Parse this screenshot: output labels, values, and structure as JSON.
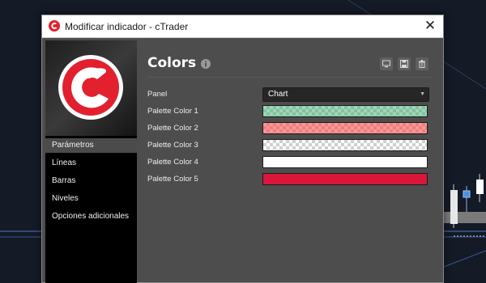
{
  "window": {
    "title": "Modificar indicador - cTrader",
    "close_glyph": "✕"
  },
  "sidebar": {
    "items": [
      {
        "label": "Parámetros",
        "active": true
      },
      {
        "label": "Líneas",
        "active": false
      },
      {
        "label": "Barras",
        "active": false
      },
      {
        "label": "Niveles",
        "active": false
      },
      {
        "label": "Opciones adicionales",
        "active": false
      }
    ]
  },
  "main": {
    "heading": "Colors",
    "header_icons": [
      "info-icon",
      "monitor-icon",
      "save-icon",
      "trash-icon"
    ],
    "fields": {
      "panel": {
        "label": "Panel",
        "value": "Chart",
        "options": [
          "Chart"
        ]
      },
      "palette_1": {
        "label": "Palette Color 1",
        "color": "#3cb371",
        "alpha": 0.5
      },
      "palette_2": {
        "label": "Palette Color 2",
        "color": "#ff4040",
        "alpha": 0.55
      },
      "palette_3": {
        "label": "Palette Color 3",
        "color": "#ffffff",
        "alpha": 0.0
      },
      "palette_4": {
        "label": "Palette Color 4",
        "color": "#ffffff",
        "alpha": 1.0
      },
      "palette_5": {
        "label": "Palette Color 5",
        "color": "#d9173a",
        "alpha": 1.0
      }
    }
  },
  "colors": {
    "brand_red": "#e3202e",
    "dialog_bg": "#4d4d4d",
    "chart_bg": "#141a26",
    "bullish_candle": "#4a90e2",
    "bearish_candle": "#ffffff"
  }
}
